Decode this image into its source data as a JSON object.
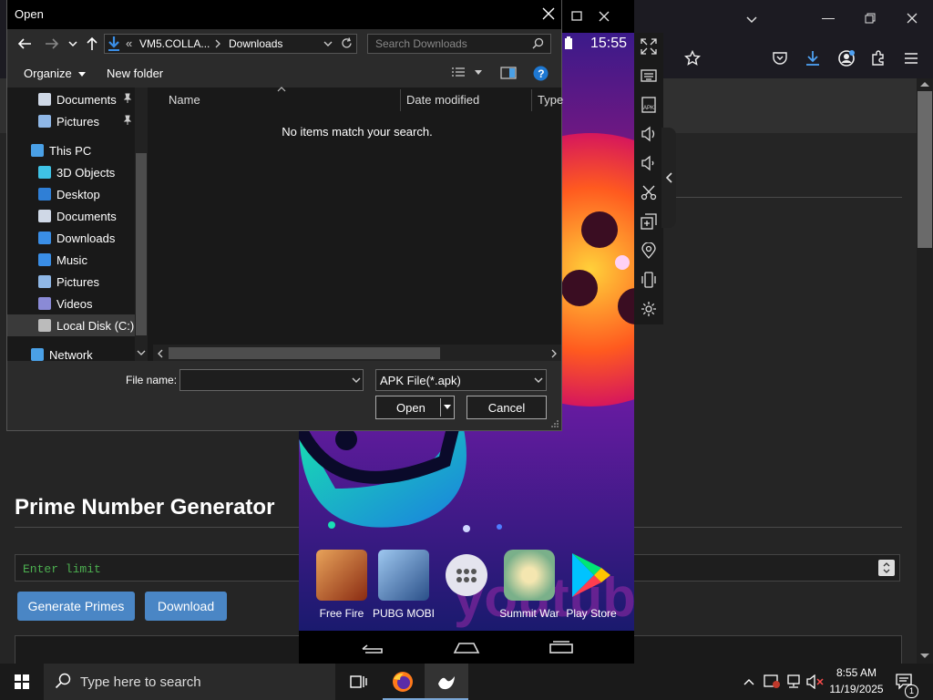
{
  "dialog": {
    "title": "Open",
    "address": {
      "prefix": "«",
      "crumb1": "VM5.COLLA...",
      "crumb2": "Downloads"
    },
    "search_placeholder": "Search Downloads",
    "organize_label": "Organize",
    "new_folder_label": "New folder",
    "nav_items": [
      {
        "label": "Documents",
        "icon": "documents-icon",
        "pinned": true
      },
      {
        "label": "Pictures",
        "icon": "pictures-icon",
        "pinned": true
      },
      {
        "label": "This PC",
        "icon": "pc-icon"
      },
      {
        "label": "3D Objects",
        "icon": "3d-objects-icon"
      },
      {
        "label": "Desktop",
        "icon": "desktop-icon"
      },
      {
        "label": "Documents",
        "icon": "documents-icon"
      },
      {
        "label": "Downloads",
        "icon": "downloads-icon"
      },
      {
        "label": "Music",
        "icon": "music-icon"
      },
      {
        "label": "Pictures",
        "icon": "pictures-icon"
      },
      {
        "label": "Videos",
        "icon": "videos-icon"
      },
      {
        "label": "Local Disk (C:)",
        "icon": "disk-icon",
        "selected": true
      },
      {
        "label": "Network",
        "icon": "network-icon"
      }
    ],
    "columns": {
      "name": "Name",
      "date": "Date modified",
      "type": "Type"
    },
    "empty_message": "No items match your search.",
    "file_name_label": "File name:",
    "file_name_value": "",
    "file_type": "APK File(*.apk)",
    "open_label": "Open",
    "cancel_label": "Cancel"
  },
  "emulator": {
    "clock": "15:55",
    "apps": [
      {
        "label": "Free Fire",
        "color": "#c84a1a"
      },
      {
        "label": "PUBG MOBI",
        "color": "#3a6fb0"
      },
      {
        "label": "Summit War",
        "color": "#7ab08a"
      },
      {
        "label": "Play Store",
        "color": "#1fa463"
      }
    ]
  },
  "webpage": {
    "title": "Prime Number Generator",
    "limit_placeholder": "Enter limit",
    "generate_label": "Generate Primes",
    "download_label": "Download"
  },
  "taskbar": {
    "search_placeholder": "Type here to search",
    "time": "8:55 AM",
    "date": "11/19/2025",
    "notification_count": "1"
  },
  "colors": {
    "accent": "#4a86c5",
    "input_text": "#4caf50",
    "link_blue": "#1a73e8"
  }
}
